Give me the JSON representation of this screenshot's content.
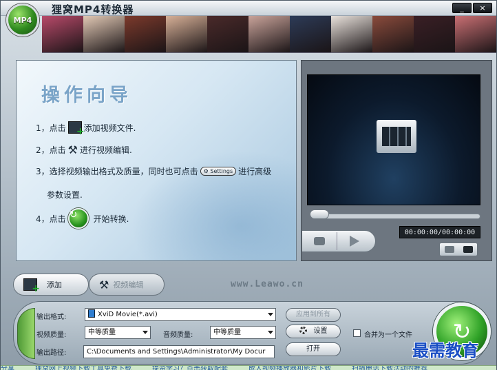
{
  "window": {
    "title": "狸窝MP4转换器",
    "logo_text": "MP4",
    "minimize_label": "_",
    "close_label": "×"
  },
  "banner_colors": [
    "#b84a6a",
    "#e2c9b5",
    "#7c3a2c",
    "#d7b097",
    "#4a2a2a",
    "#c9a39a",
    "#2d3b57",
    "#e9e2dc",
    "#8a4b3c",
    "#3a1f25",
    "#c96f73"
  ],
  "guide": {
    "title": "操作向导",
    "step1_num": "1，点击",
    "step1_text": "添加视频文件.",
    "step2_num": "2，点击",
    "step2_text": "进行视频编辑.",
    "step3_text_a": "3，选择视频输出格式及质量，同时也可点击",
    "step3_settings": "Settings",
    "step3_text_b": "进行高级",
    "step3_text_c": "参数设置.",
    "step4_num": "4，点击",
    "step4_text": "开始转换."
  },
  "player": {
    "timecode": "00:00:00/00:00:00",
    "seek_position": 0.0
  },
  "toolbar": {
    "add_label": "添加",
    "edit_label": "视频编辑",
    "watermark": "www.Leawo.cn"
  },
  "output": {
    "format_label": "输出格式:",
    "format_value": "XviD Movie(*.avi)",
    "apply_all_label": "应用到所有",
    "video_quality_label": "视频质量:",
    "video_quality_value": "中等质量",
    "audio_quality_label": "音频质量:",
    "audio_quality_value": "中等质量",
    "settings_label": "设置",
    "merge_label": "合并为一个文件",
    "merge_checked": false,
    "path_label": "输出路径:",
    "path_value": "C:\\Documents and Settings\\Administrator\\My Docur",
    "open_label": "打开"
  },
  "status_items": [
    "分享",
    "狸窝网上视频下载工具免费下载",
    "提资学习？点击获取配套",
    "成人视频播放器和影片下载",
    "扫描电话下载活动的推荐"
  ],
  "overlay_brand": "最需教育"
}
